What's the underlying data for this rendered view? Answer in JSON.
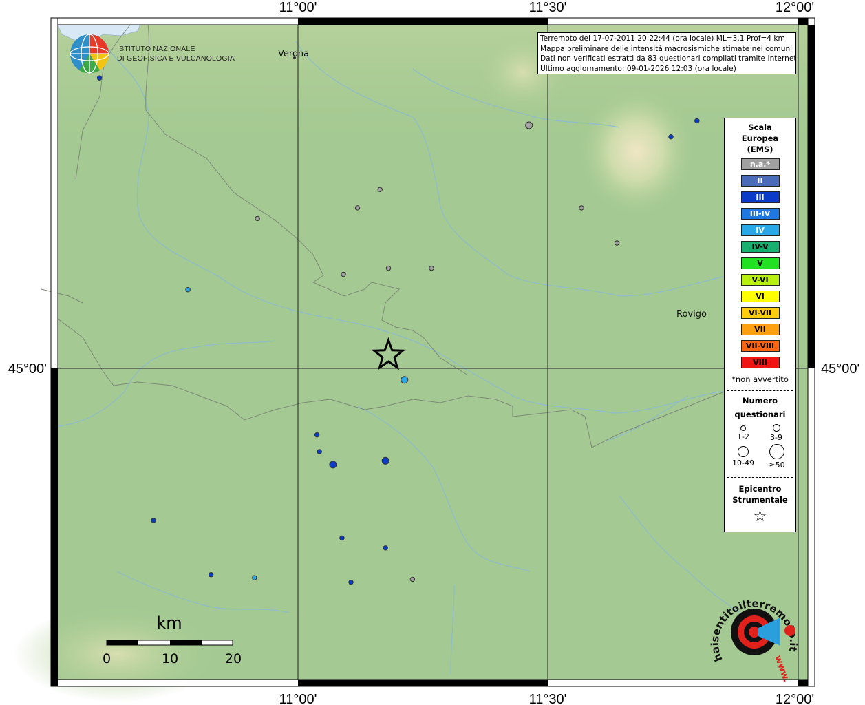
{
  "axis": {
    "top_labels": [
      "11°00'",
      "11°30'",
      "12°00'"
    ],
    "bottom_labels": [
      "11°00'",
      "11°30'",
      "12°00'"
    ],
    "left_label": "45°00'",
    "right_label": "45°00'"
  },
  "header_info": {
    "line1": "Terremoto del 17-07-2011 20:22:44 (ora locale) ML=3.1 Prof=4 km",
    "line2": "Mappa preliminare delle intensità macrosismiche stimate nei comuni",
    "line3": "Dati non verificati estratti da 83 questionari compilati tramite Internet.",
    "line4": "Ultimo aggiornamento: 09-01-2026 12:03 (ora locale)"
  },
  "institute": {
    "line1": "ISTITUTO NAZIONALE",
    "line2": "DI GEOFISICA E VULCANOLOGIA"
  },
  "cities": [
    {
      "name": "Verona"
    },
    {
      "name": "Rovigo"
    }
  ],
  "legend": {
    "title1": "Scala",
    "title2": "Europea",
    "title3": "(EMS)",
    "items": [
      {
        "label": "n.a.*",
        "color": "#a0a0a0",
        "text_color": "#ffffff"
      },
      {
        "label": "II",
        "color": "#4a6cb8",
        "text_color": "#ffffff"
      },
      {
        "label": "III",
        "color": "#0a3cc8",
        "text_color": "#ffffff"
      },
      {
        "label": "III-IV",
        "color": "#1e78e0",
        "text_color": "#ffffff"
      },
      {
        "label": "IV",
        "color": "#29a8e8",
        "text_color": "#ffffff"
      },
      {
        "label": "IV-V",
        "color": "#17b06e",
        "text_color": "#000000"
      },
      {
        "label": "V",
        "color": "#22e022",
        "text_color": "#000000"
      },
      {
        "label": "V-VI",
        "color": "#b8f010",
        "text_color": "#000000"
      },
      {
        "label": "VI",
        "color": "#ffff00",
        "text_color": "#000000"
      },
      {
        "label": "VI-VII",
        "color": "#ffcc10",
        "text_color": "#000000"
      },
      {
        "label": "VII",
        "color": "#ffa010",
        "text_color": "#000000"
      },
      {
        "label": "VII-VIII",
        "color": "#ff6410",
        "text_color": "#000000"
      },
      {
        "label": "VIII",
        "color": "#f01414",
        "text_color": "#000000"
      }
    ],
    "note": "*non avvertito",
    "count_title1": "Numero",
    "count_title2": "questionari",
    "sizes": [
      "1-2",
      "3-9",
      "10-49",
      "≥50"
    ],
    "epicenter_title1": "Epicentro",
    "epicenter_title2": "Strumentale",
    "star_glyph": "☆"
  },
  "scalebar": {
    "unit": "km",
    "ticks": [
      "0",
      "10",
      "20"
    ]
  },
  "haisentito": {
    "text": "haisentitoilterremoto.it",
    "www": "www."
  },
  "points": [
    {
      "lon": 10.603,
      "lat": 45.38,
      "intensity": "III",
      "count": "1-2"
    },
    {
      "lon": 11.462,
      "lat": 45.318,
      "intensity": "n.a.*",
      "count": "3-9"
    },
    {
      "lon": 11.746,
      "lat": 45.303,
      "intensity": "III",
      "count": "1-2"
    },
    {
      "lon": 11.798,
      "lat": 45.324,
      "intensity": "III",
      "count": "1-2"
    },
    {
      "lon": 11.164,
      "lat": 45.234,
      "intensity": "n.a.*",
      "count": "1-2"
    },
    {
      "lon": 11.119,
      "lat": 45.21,
      "intensity": "n.a.*",
      "count": "1-2"
    },
    {
      "lon": 11.567,
      "lat": 45.21,
      "intensity": "n.a.*",
      "count": "1-2"
    },
    {
      "lon": 10.919,
      "lat": 45.196,
      "intensity": "n.a.*",
      "count": "1-2"
    },
    {
      "lon": 11.638,
      "lat": 45.164,
      "intensity": "n.a.*",
      "count": "1-2"
    },
    {
      "lon": 11.091,
      "lat": 45.123,
      "intensity": "n.a.*",
      "count": "1-2"
    },
    {
      "lon": 11.181,
      "lat": 45.131,
      "intensity": "n.a.*",
      "count": "1-2"
    },
    {
      "lon": 11.267,
      "lat": 45.131,
      "intensity": "n.a.*",
      "count": "1-2"
    },
    {
      "lon": 10.78,
      "lat": 45.103,
      "intensity": "IV",
      "count": "1-2"
    },
    {
      "lon": 11.213,
      "lat": 44.985,
      "intensity": "IV",
      "count": "3-9"
    },
    {
      "lon": 11.038,
      "lat": 44.913,
      "intensity": "III",
      "count": "1-2"
    },
    {
      "lon": 11.043,
      "lat": 44.891,
      "intensity": "III",
      "count": "1-2"
    },
    {
      "lon": 11.175,
      "lat": 44.879,
      "intensity": "III",
      "count": "3-9"
    },
    {
      "lon": 11.07,
      "lat": 44.874,
      "intensity": "III",
      "count": "3-9"
    },
    {
      "lon": 10.711,
      "lat": 44.801,
      "intensity": "III",
      "count": "1-2"
    },
    {
      "lon": 11.088,
      "lat": 44.778,
      "intensity": "III",
      "count": "1-2"
    },
    {
      "lon": 11.175,
      "lat": 44.765,
      "intensity": "III",
      "count": "1-2"
    },
    {
      "lon": 10.826,
      "lat": 44.73,
      "intensity": "III",
      "count": "1-2"
    },
    {
      "lon": 10.913,
      "lat": 44.726,
      "intensity": "IV",
      "count": "1-2"
    },
    {
      "lon": 11.106,
      "lat": 44.72,
      "intensity": "III",
      "count": "1-2"
    },
    {
      "lon": 11.229,
      "lat": 44.724,
      "intensity": "n.a.*",
      "count": "1-2"
    }
  ],
  "epicenter": {
    "lon": 11.181,
    "lat": 45.017
  }
}
